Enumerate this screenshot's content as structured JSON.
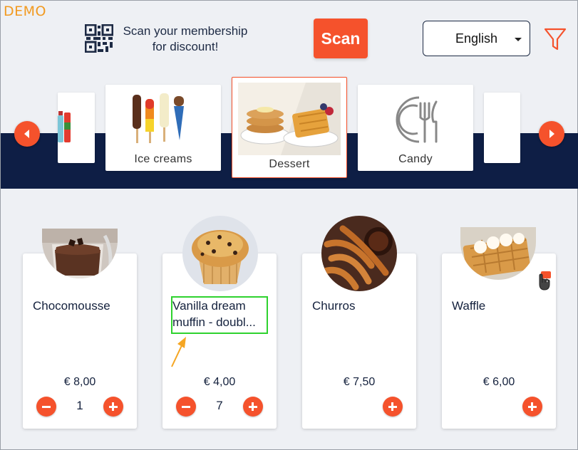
{
  "header": {
    "demo_label": "DEMO",
    "scan_line1": "Scan your membership",
    "scan_line2": "for discount!",
    "scan_button": "Scan",
    "language": "English"
  },
  "categories": [
    {
      "label": ""
    },
    {
      "label": "Ice creams"
    },
    {
      "label": "Dessert",
      "selected": true
    },
    {
      "label": "Candy"
    },
    {
      "label": ""
    }
  ],
  "products": [
    {
      "name": "Chocomousse",
      "price": "€ 8,00",
      "quantity": "1",
      "image": "chocolate-mousse-glass"
    },
    {
      "name": "Vanilla dream muffin - doubl...",
      "price": "€ 4,00",
      "quantity": "7",
      "image": "chocolate-chip-muffin"
    },
    {
      "name": "Churros",
      "price": "€ 7,50",
      "quantity": "",
      "image": "churros-with-chocolate"
    },
    {
      "name": "Waffle",
      "price": "€ 6,00",
      "quantity": "",
      "image": "waffle-with-cream"
    }
  ],
  "colors": {
    "accent": "#f5522c",
    "navy": "#0e1e45",
    "demo": "#f29a20",
    "highlight": "#2ed22e",
    "pointer": "#f5a623"
  }
}
